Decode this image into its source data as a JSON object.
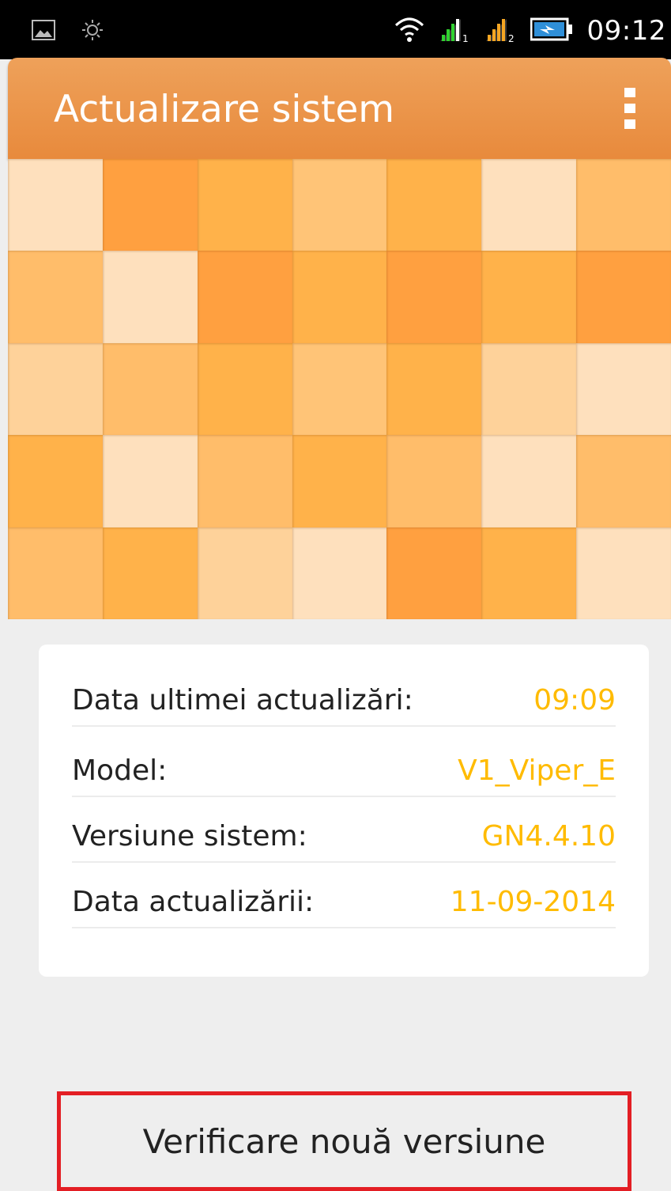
{
  "status_bar": {
    "time": "09:12",
    "icons": [
      "image-notification-icon",
      "brightness-icon",
      "wifi-icon",
      "signal-sim1-icon",
      "signal-sim2-icon",
      "battery-charging-icon"
    ]
  },
  "app_bar": {
    "title": "Actualizare sistem",
    "menu_icon": "overflow-menu-icon"
  },
  "info": {
    "rows": [
      {
        "label": "Data ultimei actualizări:",
        "value": "09:09"
      },
      {
        "label": "Model:",
        "value": "V1_Viper_E"
      },
      {
        "label": "Versiune sistem:",
        "value": "GN4.4.10"
      },
      {
        "label": "Data actualizării:",
        "value": "11-09-2014"
      }
    ]
  },
  "actions": {
    "check_update": "Verificare nouă versiune"
  },
  "colors": {
    "accent_orange": "#e88a3c",
    "value_yellow": "#ffbb00",
    "highlight_red": "#e31e24"
  }
}
